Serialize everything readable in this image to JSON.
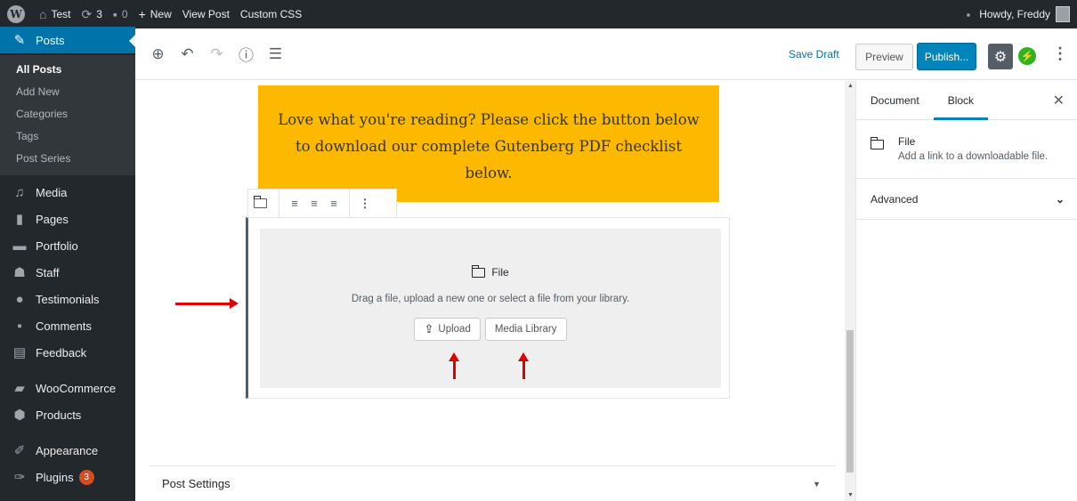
{
  "adminbar": {
    "wp_logo": "W",
    "site_name": "Test",
    "updates_count": "3",
    "comments_count": "0",
    "new_label": "New",
    "view_post_label": "View Post",
    "custom_css_label": "Custom CSS",
    "howdy": "Howdy, Freddy"
  },
  "sidebar": {
    "current": "Posts",
    "submenu": [
      "All Posts",
      "Add New",
      "Categories",
      "Tags",
      "Post Series"
    ],
    "items": [
      {
        "label": "Media",
        "icon": "media-icon"
      },
      {
        "label": "Pages",
        "icon": "pages-icon"
      },
      {
        "label": "Portfolio",
        "icon": "portfolio-icon"
      },
      {
        "label": "Staff",
        "icon": "staff-icon"
      },
      {
        "label": "Testimonials",
        "icon": "testimonials-icon"
      },
      {
        "label": "Comments",
        "icon": "comments-icon"
      },
      {
        "label": "Feedback",
        "icon": "feedback-icon"
      },
      {
        "label": "WooCommerce",
        "icon": "woocommerce-icon"
      },
      {
        "label": "Products",
        "icon": "products-icon"
      },
      {
        "label": "Appearance",
        "icon": "appearance-icon"
      },
      {
        "label": "Plugins",
        "icon": "plugins-icon",
        "badge": "3"
      }
    ]
  },
  "toolbar": {
    "save_draft": "Save Draft",
    "preview": "Preview",
    "publish": "Publish...",
    "jetpack": "⚡",
    "more": "⋮"
  },
  "editor": {
    "cta_text": "Love what you're reading? Please click the button below to download our complete Gutenberg PDF checklist below.",
    "file_block": {
      "title": "File",
      "instructions": "Drag a file, upload a new one or select a file from your library.",
      "upload_label": "Upload",
      "media_library_label": "Media Library"
    },
    "post_settings": "Post Settings"
  },
  "panel": {
    "tab_document": "Document",
    "tab_block": "Block",
    "block_name": "File",
    "block_description": "Add a link to a downloadable file.",
    "advanced": "Advanced"
  },
  "colors": {
    "admin_dark": "#23282d",
    "accent_blue": "#0085ba",
    "cta_yellow": "#fdb900",
    "annotation_red": "#e10000"
  }
}
